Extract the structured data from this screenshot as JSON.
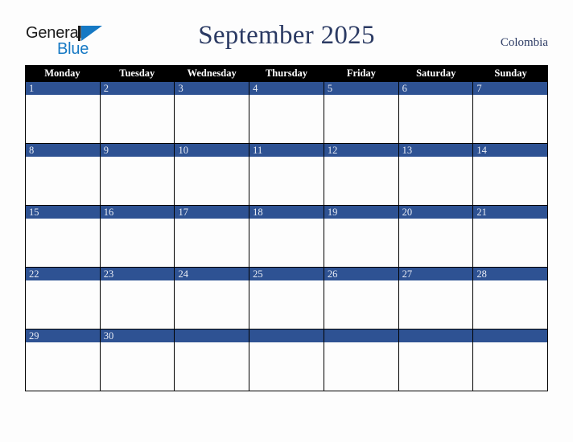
{
  "brand": {
    "name_part1": "General",
    "name_part2": "Blue",
    "triangle_icon": "triangle-icon",
    "colors": {
      "dark": "#1c1c1c",
      "blue": "#1679c4"
    }
  },
  "header": {
    "title": "September 2025",
    "country": "Colombia",
    "title_color": "#2b3a63"
  },
  "calendar": {
    "colors": {
      "dow_background": "#000000",
      "dow_text": "#ffffff",
      "day_number_background": "#2e5293",
      "day_number_text": "#e8ecf5",
      "cell_background": "#fdfdfd",
      "border": "#000000"
    },
    "day_headers": [
      "Monday",
      "Tuesday",
      "Wednesday",
      "Thursday",
      "Friday",
      "Saturday",
      "Sunday"
    ],
    "weeks": [
      [
        "1",
        "2",
        "3",
        "4",
        "5",
        "6",
        "7"
      ],
      [
        "8",
        "9",
        "10",
        "11",
        "12",
        "13",
        "14"
      ],
      [
        "15",
        "16",
        "17",
        "18",
        "19",
        "20",
        "21"
      ],
      [
        "22",
        "23",
        "24",
        "25",
        "26",
        "27",
        "28"
      ],
      [
        "29",
        "30",
        "",
        "",
        "",
        "",
        ""
      ]
    ]
  }
}
